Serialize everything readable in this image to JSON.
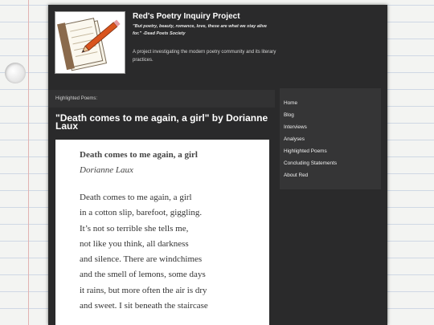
{
  "site": {
    "title": "Red's Poetry Inquiry Project",
    "tagline": "\"But poetry, beauty, romance, love, these are what we stay alive for.\" -Dead Poets Society",
    "description": "A project investigating the modern poetry community and its literary practices."
  },
  "section_label": "Highlighted Poems:",
  "post": {
    "title": "\"Death comes to me again, a girl\" by Dorianne Laux"
  },
  "poem": {
    "title": "Death comes to me again, a girl",
    "author": "Dorianne Laux",
    "lines": [
      "Death comes to me again, a girl",
      "in a cotton slip, barefoot, giggling.",
      "It’s not so terrible she tells me,",
      "not like you think, all darkness",
      "and silence. There are windchimes",
      "and the smell of lemons, some days",
      "it rains, but more often the air is dry",
      "and sweet. I sit beneath the staircase"
    ]
  },
  "nav": {
    "items": [
      "Home",
      "Blog",
      "Interviews",
      "Analyses",
      "Highlighted Poems",
      "Concluding Statements",
      "About Red"
    ]
  },
  "icons": {
    "logo": "notepad-pencil-icon",
    "hole": "paper-hole-icon"
  },
  "colors": {
    "page_bg": "#2a2a2b",
    "sidebar_bg": "#353536",
    "paper_line": "#cfd8e4"
  }
}
